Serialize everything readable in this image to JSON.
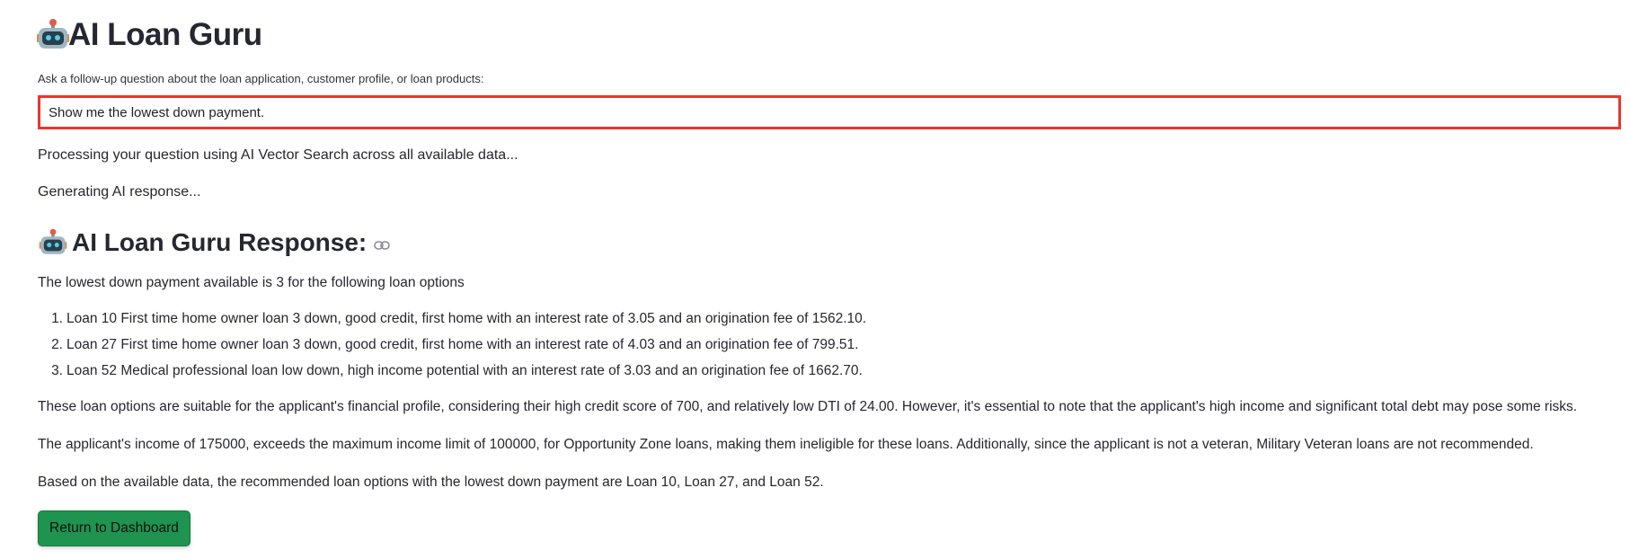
{
  "header": {
    "title": "AI Loan Guru",
    "icon": "robot-icon"
  },
  "question": {
    "label": "Ask a follow-up question about the loan application, customer profile, or loan products:",
    "value": "Show me the lowest down payment."
  },
  "status": {
    "processing": "Processing your question using AI Vector Search across all available data...",
    "generating": "Generating AI response..."
  },
  "response": {
    "heading": "AI Loan Guru Response:",
    "intro": "The lowest down payment available is 3 for the following loan options",
    "items": [
      "Loan 10 First time home owner loan 3 down, good credit, first home with an interest rate of 3.05 and an origination fee of 1562.10.",
      "Loan 27 First time home owner loan 3 down, good credit, first home with an interest rate of 4.03 and an origination fee of 799.51.",
      "Loan 52 Medical professional loan low down, high income potential with an interest rate of 3.03 and an origination fee of 1662.70."
    ],
    "item_numbers": [
      "1.",
      "2.",
      "3."
    ],
    "paragraph1": "These loan options are suitable for the applicant's financial profile, considering their high credit score of 700, and relatively low DTI of 24.00. However, it's essential to note that the applicant's high income and significant total debt may pose some risks.",
    "paragraph2": "The applicant's income of 175000, exceeds the maximum income limit of 100000, for Opportunity Zone loans, making them ineligible for these loans. Additionally, since the applicant is not a veteran, Military Veteran loans are not recommended.",
    "paragraph3": "Based on the available data, the recommended loan options with the lowest down payment are Loan 10, Loan 27, and Loan 52."
  },
  "actions": {
    "return_label": "Return to Dashboard"
  },
  "colors": {
    "input_border": "#e8372e",
    "button_bg": "#1f9350"
  }
}
